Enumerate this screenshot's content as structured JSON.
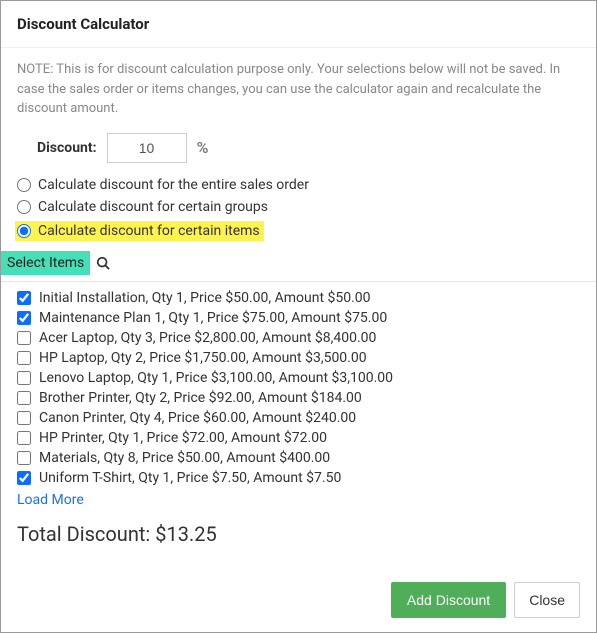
{
  "header": {
    "title": "Discount Calculator"
  },
  "note": "NOTE: This is for discount calculation purpose only. Your selections below will not be saved. In case the sales order or items changes, you can use the calculator again and recalculate the discount amount.",
  "discount": {
    "label": "Discount:",
    "value": "10",
    "unit": "%"
  },
  "radios": {
    "entire": "Calculate discount for the entire sales order",
    "groups": "Calculate discount for certain groups",
    "items": "Calculate discount for certain items"
  },
  "select_items_label": "Select Items",
  "items": [
    {
      "checked": true,
      "text": "Initial Installation, Qty 1, Price $50.00, Amount $50.00"
    },
    {
      "checked": true,
      "text": "Maintenance Plan 1, Qty 1, Price $75.00, Amount $75.00"
    },
    {
      "checked": false,
      "text": "Acer Laptop, Qty 3, Price $2,800.00, Amount $8,400.00"
    },
    {
      "checked": false,
      "text": "HP Laptop, Qty 2, Price $1,750.00, Amount $3,500.00"
    },
    {
      "checked": false,
      "text": "Lenovo Laptop, Qty 1, Price $3,100.00, Amount $3,100.00"
    },
    {
      "checked": false,
      "text": "Brother Printer, Qty 2, Price $92.00, Amount $184.00"
    },
    {
      "checked": false,
      "text": "Canon Printer, Qty 4, Price $60.00, Amount $240.00"
    },
    {
      "checked": false,
      "text": "HP Printer, Qty 1, Price $72.00, Amount $72.00"
    },
    {
      "checked": false,
      "text": "Materials, Qty 8, Price $50.00, Amount $400.00"
    },
    {
      "checked": true,
      "text": "Uniform T-Shirt, Qty 1, Price $7.50, Amount $7.50"
    }
  ],
  "load_more": "Load More",
  "total_label": "Total Discount: $13.25",
  "buttons": {
    "add": "Add Discount",
    "close": "Close"
  }
}
